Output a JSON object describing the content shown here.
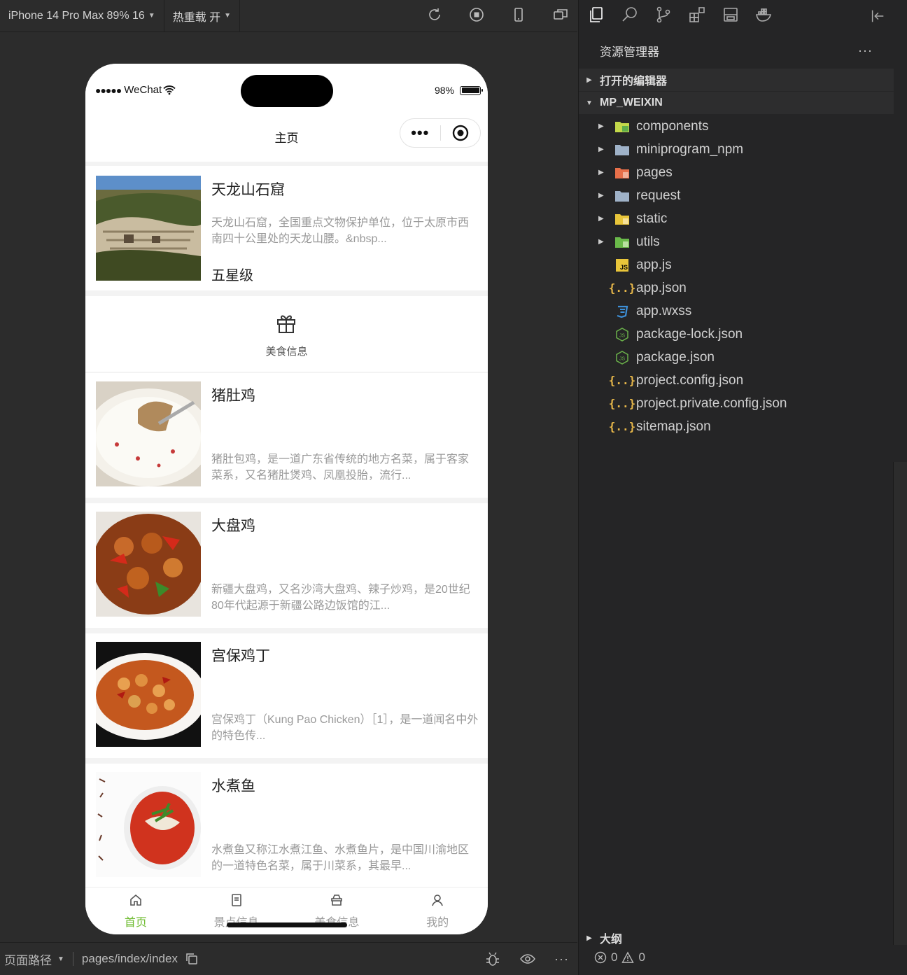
{
  "toolbar": {
    "device": "iPhone 14 Pro Max 89% 16",
    "hot_reload": "热重载 开"
  },
  "phone": {
    "carrier": "WeChat",
    "battery": "98%",
    "nav_title": "主页",
    "scenic": {
      "title": "天龙山石窟",
      "desc": "天龙山石窟，全国重点文物保护单位，位于太原市西南四十公里处的天龙山腰。&nbsp...",
      "rank": "五星级"
    },
    "food_section_label": "美食信息",
    "foods": [
      {
        "title": "猪肚鸡",
        "desc": "猪肚包鸡，是一道广东省传统的地方名菜，属于客家菜系，又名猪肚煲鸡、凤凰投胎，流行..."
      },
      {
        "title": "大盘鸡",
        "desc": "新疆大盘鸡，又名沙湾大盘鸡、辣子炒鸡，是20世纪80年代起源于新疆公路边饭馆的江..."
      },
      {
        "title": "宫保鸡丁",
        "desc": "宫保鸡丁（Kung Pao Chicken）［1］，是一道闻名中外的特色传..."
      },
      {
        "title": "水煮鱼",
        "desc": "水煮鱼又称江水煮江鱼、水煮鱼片，是中国川渝地区的一道特色名菜，属于川菜系，其最早..."
      }
    ],
    "tabs": [
      {
        "label": "首页",
        "icon": "home-icon"
      },
      {
        "label": "景点信息",
        "icon": "document-icon"
      },
      {
        "label": "美食信息",
        "icon": "food-icon"
      },
      {
        "label": "我的",
        "icon": "user-icon"
      }
    ],
    "active_tab_color": "#6dbb2e"
  },
  "footer": {
    "path_label": "页面路径",
    "path": "pages/index/index"
  },
  "explorer": {
    "title": "资源管理器",
    "open_editors": "打开的编辑器",
    "project": "MP_WEIXIN",
    "items": [
      {
        "name": "components",
        "kind": "folder",
        "icon": "folder-components-icon",
        "color": "#c3d94a"
      },
      {
        "name": "miniprogram_npm",
        "kind": "folder",
        "icon": "folder-icon",
        "color": "#9fb2c8"
      },
      {
        "name": "pages",
        "kind": "folder",
        "icon": "folder-pages-icon",
        "color": "#e8704a"
      },
      {
        "name": "request",
        "kind": "folder",
        "icon": "folder-icon",
        "color": "#9fb2c8"
      },
      {
        "name": "static",
        "kind": "folder",
        "icon": "folder-static-icon",
        "color": "#e8c53a"
      },
      {
        "name": "utils",
        "kind": "folder",
        "icon": "folder-utils-icon",
        "color": "#6aba4a"
      },
      {
        "name": "app.js",
        "kind": "js",
        "icon": "js-file-icon"
      },
      {
        "name": "app.json",
        "kind": "json",
        "icon": "json-file-icon"
      },
      {
        "name": "app.wxss",
        "kind": "css",
        "icon": "css-file-icon"
      },
      {
        "name": "package-lock.json",
        "kind": "node",
        "icon": "nodejs-file-icon"
      },
      {
        "name": "package.json",
        "kind": "node",
        "icon": "nodejs-file-icon"
      },
      {
        "name": "project.config.json",
        "kind": "json",
        "icon": "json-file-icon"
      },
      {
        "name": "project.private.config.json",
        "kind": "json",
        "icon": "json-file-icon"
      },
      {
        "name": "sitemap.json",
        "kind": "json",
        "icon": "json-file-icon"
      }
    ],
    "outline": "大纲",
    "errors": "0",
    "warnings": "0"
  }
}
